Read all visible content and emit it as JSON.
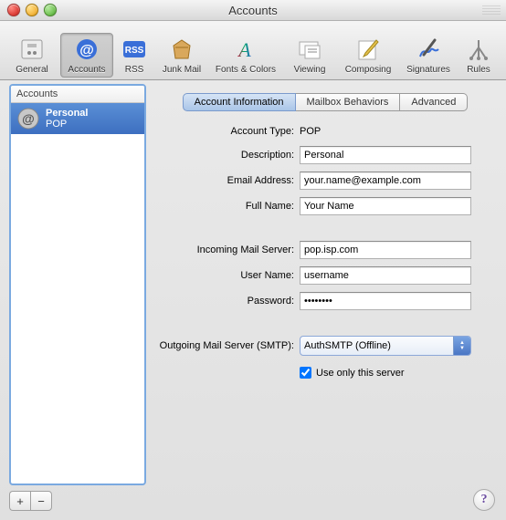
{
  "window": {
    "title": "Accounts"
  },
  "toolbar": {
    "items": [
      {
        "label": "General"
      },
      {
        "label": "Accounts"
      },
      {
        "label": "RSS"
      },
      {
        "label": "Junk Mail"
      },
      {
        "label": "Fonts & Colors"
      },
      {
        "label": "Viewing"
      },
      {
        "label": "Composing"
      },
      {
        "label": "Signatures"
      },
      {
        "label": "Rules"
      }
    ],
    "selected": 1
  },
  "sidebar": {
    "header": "Accounts",
    "items": [
      {
        "name": "Personal",
        "sub": "POP"
      }
    ],
    "add_label": "+",
    "remove_label": "−"
  },
  "tabs": {
    "items": [
      "Account Information",
      "Mailbox Behaviors",
      "Advanced"
    ],
    "active": 0
  },
  "form": {
    "account_type_label": "Account Type:",
    "account_type_value": "POP",
    "description_label": "Description:",
    "description_value": "Personal",
    "email_label": "Email Address:",
    "email_value": "your.name@example.com",
    "fullname_label": "Full Name:",
    "fullname_value": "Your Name",
    "incoming_label": "Incoming Mail Server:",
    "incoming_value": "pop.isp.com",
    "username_label": "User Name:",
    "username_value": "username",
    "password_label": "Password:",
    "password_value": "••••••••",
    "smtp_label": "Outgoing Mail Server (SMTP):",
    "smtp_value": "AuthSMTP (Offline)",
    "use_only_label": "Use only this server",
    "use_only_checked": true
  },
  "help_label": "?"
}
